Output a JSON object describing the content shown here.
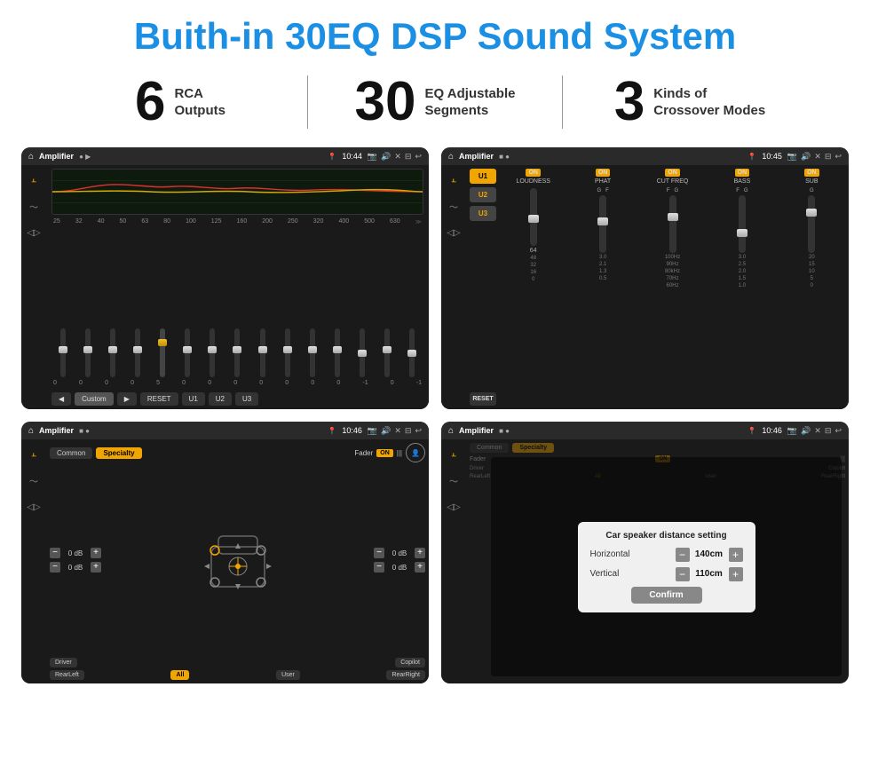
{
  "header": {
    "title": "Buith-in 30EQ DSP Sound System"
  },
  "stats": [
    {
      "number": "6",
      "text_line1": "RCA",
      "text_line2": "Outputs"
    },
    {
      "number": "30",
      "text_line1": "EQ Adjustable",
      "text_line2": "Segments"
    },
    {
      "number": "3",
      "text_line1": "Kinds of",
      "text_line2": "Crossover Modes"
    }
  ],
  "screens": [
    {
      "id": "eq-screen",
      "topbar": {
        "app": "Amplifier",
        "time": "10:44"
      },
      "eq_labels": [
        "25",
        "32",
        "40",
        "50",
        "63",
        "80",
        "100",
        "125",
        "160",
        "200",
        "250",
        "320",
        "400",
        "500",
        "630"
      ],
      "eq_values": [
        "0",
        "0",
        "0",
        "0",
        "5",
        "0",
        "0",
        "0",
        "0",
        "0",
        "0",
        "0",
        "-1",
        "0",
        "-1"
      ],
      "presets": [
        "Custom",
        "RESET",
        "U1",
        "U2",
        "U3"
      ]
    },
    {
      "id": "crossover-screen",
      "topbar": {
        "app": "Amplifier",
        "time": "10:45"
      },
      "presets": [
        "U1",
        "U2",
        "U3",
        "RESET"
      ],
      "channels": [
        {
          "label": "LOUDNESS",
          "on": true
        },
        {
          "label": "PHAT",
          "on": true
        },
        {
          "label": "CUT FREQ",
          "on": true
        },
        {
          "label": "BASS",
          "on": true
        },
        {
          "label": "SUB",
          "on": true
        }
      ]
    },
    {
      "id": "speaker-screen",
      "topbar": {
        "app": "Amplifier",
        "time": "10:46"
      },
      "tabs": [
        "Common",
        "Specialty"
      ],
      "active_tab": "Specialty",
      "fader_label": "Fader",
      "fader_on": "ON",
      "db_values": [
        "0 dB",
        "0 dB",
        "0 dB",
        "0 dB"
      ],
      "buttons": [
        "Driver",
        "Copilot",
        "RearLeft",
        "All",
        "User",
        "RearRight"
      ]
    },
    {
      "id": "dialog-screen",
      "topbar": {
        "app": "Amplifier",
        "time": "10:46"
      },
      "dialog": {
        "title": "Car speaker distance setting",
        "horizontal_label": "Horizontal",
        "horizontal_value": "140cm",
        "vertical_label": "Vertical",
        "vertical_value": "110cm",
        "confirm_label": "Confirm"
      },
      "buttons": [
        "Driver",
        "Copilot",
        "RearLeft",
        "All",
        "User",
        "RearRight"
      ]
    }
  ]
}
